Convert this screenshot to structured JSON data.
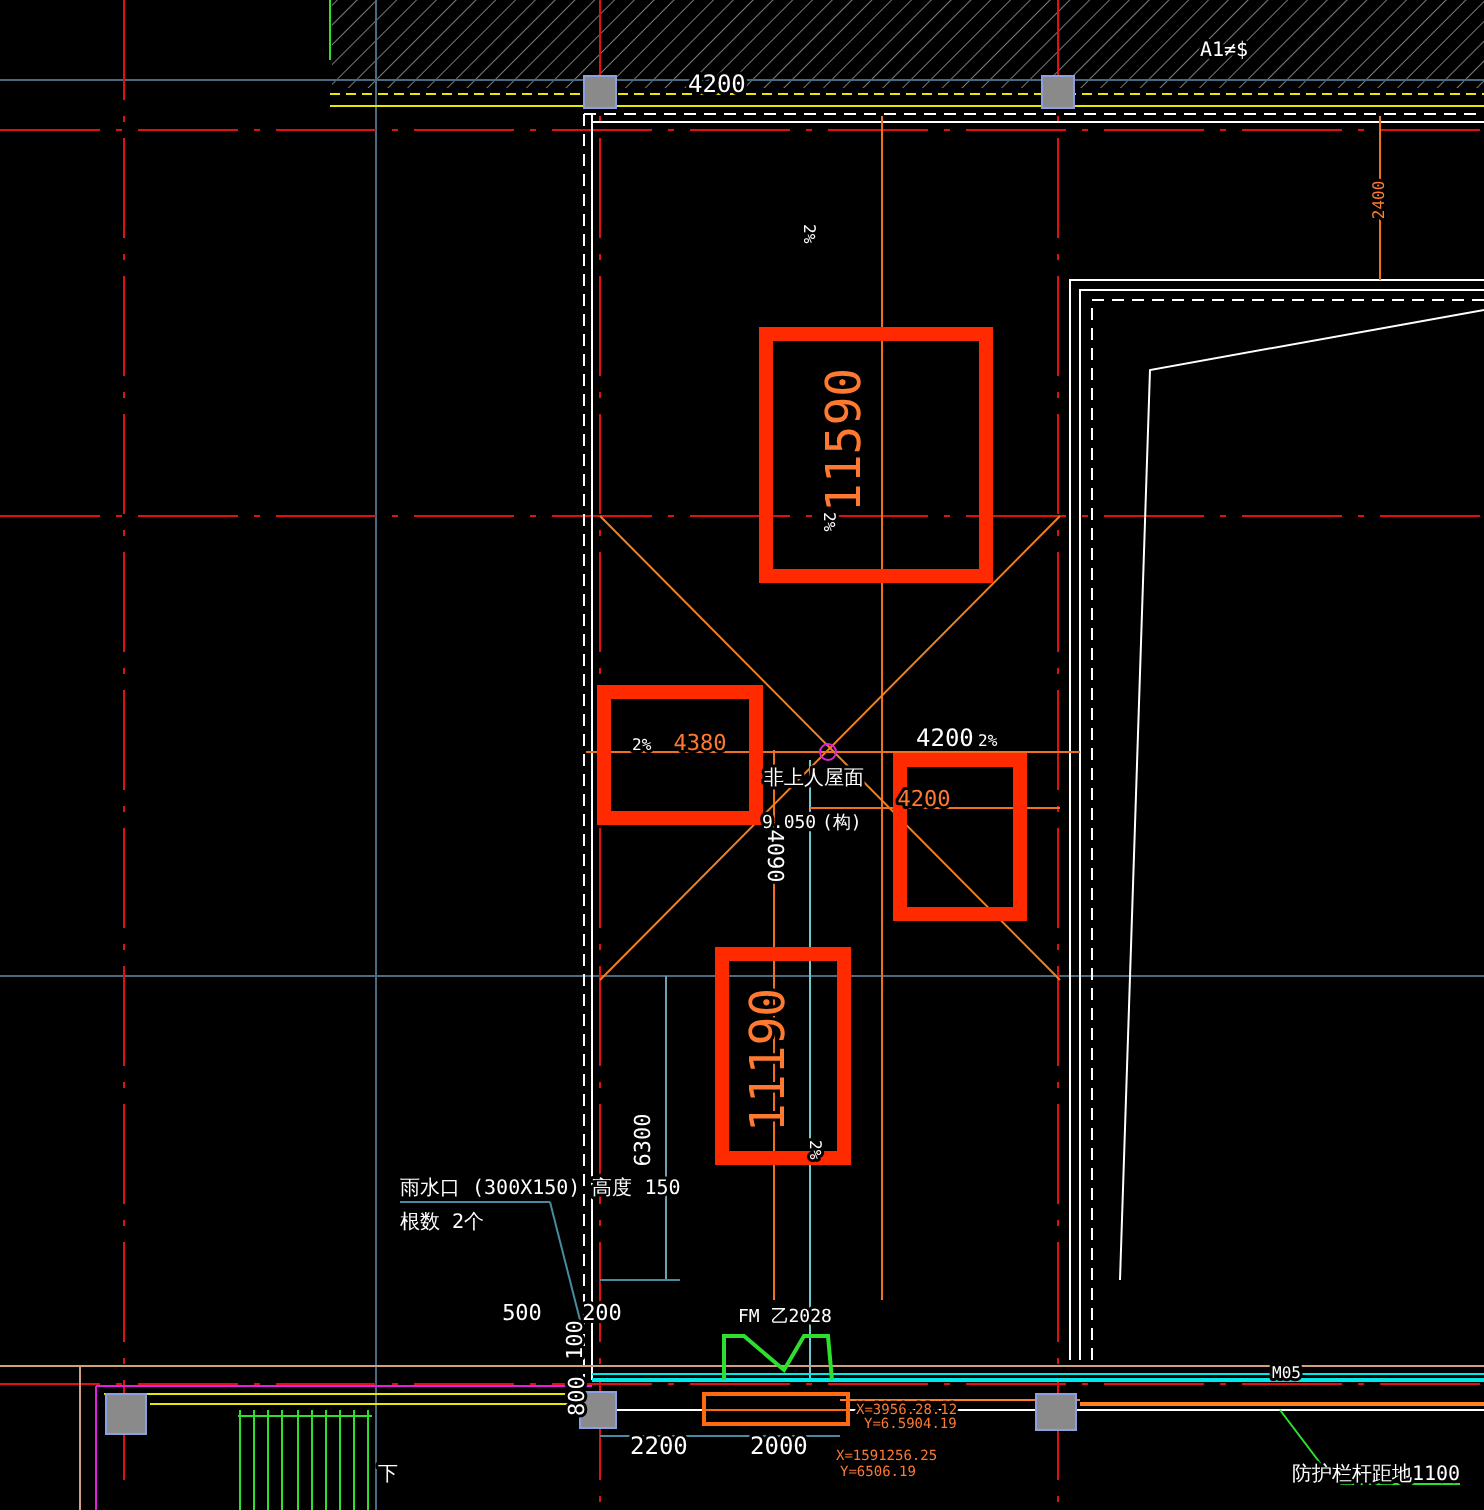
{
  "grid_label": "A1≠$",
  "top_dimension": "4200",
  "side_dimension": "2400",
  "slopes": [
    "2%",
    "2%",
    "2%",
    "2%",
    "2%"
  ],
  "highlighted_dimensions": [
    "11590",
    "4380",
    "4200",
    "11190"
  ],
  "cross_dimension": "4200",
  "roof_label": "非上人屋面",
  "elevation": "9.050",
  "elevation_note": "(构)",
  "vertical_dimensions": [
    "4090",
    "6300"
  ],
  "drain_note": [
    "雨水口 (300X150) 高度 150",
    "根数 2个"
  ],
  "small_dimensions": [
    "500",
    "200",
    "100",
    "800"
  ],
  "door_label": "FM 乙2028",
  "bottom_dimensions": [
    "2200",
    "2000"
  ],
  "coordinates": [
    "X=3956.28.12",
    "Y=6.5904.19",
    "X=1591256.25",
    "Y=6506.19"
  ],
  "window_label": "M05",
  "railing_note": "防护栏杆距地1100",
  "stair_label": "下"
}
